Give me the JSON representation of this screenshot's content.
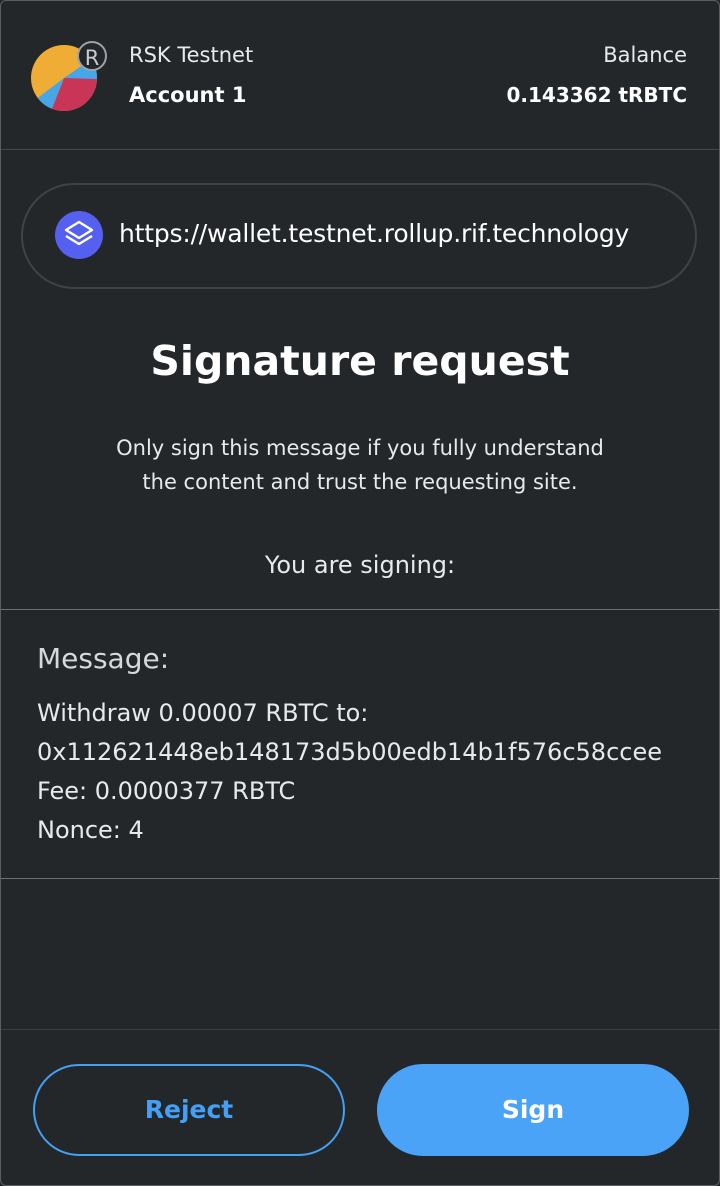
{
  "header": {
    "network_badge": "R",
    "network_name": "RSK Testnet",
    "account_name": "Account 1",
    "balance_label": "Balance",
    "balance_value": "0.143362 tRBTC"
  },
  "origin": {
    "icon": "layers-icon",
    "url": "https://wallet.testnet.rollup.rif.technology"
  },
  "request": {
    "title": "Signature request",
    "warning_line1": "Only sign this message if you fully understand",
    "warning_line2": "the content and trust the requesting site.",
    "signing_label": "You are signing:"
  },
  "message": {
    "heading": "Message:",
    "lines": [
      "Withdraw 0.00007 RBTC to:",
      "0x112621448eb148173d5b00edb14b1f576c58ccee",
      "Fee: 0.0000377 RBTC",
      "Nonce: 4"
    ]
  },
  "actions": {
    "reject_label": "Reject",
    "sign_label": "Sign"
  },
  "colors": {
    "background": "#24272a",
    "accent": "#43a0f5",
    "origin_icon": "#5560f0"
  }
}
